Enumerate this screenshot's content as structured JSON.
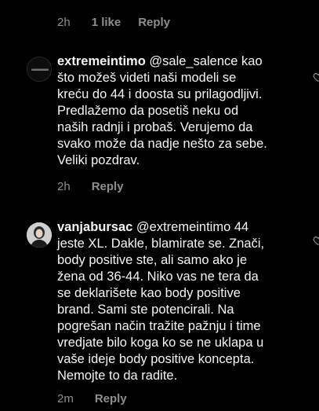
{
  "previous_comment": {
    "timestamp": "2h",
    "likes": "1 like",
    "reply_label": "Reply"
  },
  "comments": [
    {
      "username": "extremeintimo",
      "mention": "@sale_salence",
      "text_lines": [
        " kao",
        "što možeš videti naši modeli se",
        "kreću do 44 i doosta su prilagodljivi.",
        "Predlažemo da posetiš neku od",
        "naših radnji i probaš. Verujemo da",
        "svako može da nadje nešto za sebe.",
        "Veliki pozdrav."
      ],
      "timestamp": "2h",
      "reply_label": "Reply",
      "avatar_color": "#111111"
    },
    {
      "username": "vanjabursac",
      "mention": "@extremeintimo",
      "text_lines": [
        " 44",
        "jeste XL. Dakle, blamirate se. Znači,",
        "body positive ste, ali samo ako je",
        "žena od 36-44. Niko vas ne tera da",
        "se deklarišete kao body positive",
        "brand. Sami ste potencirali. Na",
        "pogrešan način tražite pažnju i time",
        "vredjate bilo koga ko se ne uklapa u",
        "vaše ideje body positive koncepta.",
        "Nemojte to da radite."
      ],
      "timestamp": "2m",
      "reply_label": "Reply",
      "avatar_color": "#d9d9d9"
    }
  ],
  "icons": {
    "like": "heart-outline-icon",
    "avatar1": "extremeintimo-logo-avatar",
    "avatar2": "user-photo-avatar"
  },
  "colors": {
    "background": "#000000",
    "text": "#f5f5f5",
    "secondary": "#8e8e8e"
  }
}
